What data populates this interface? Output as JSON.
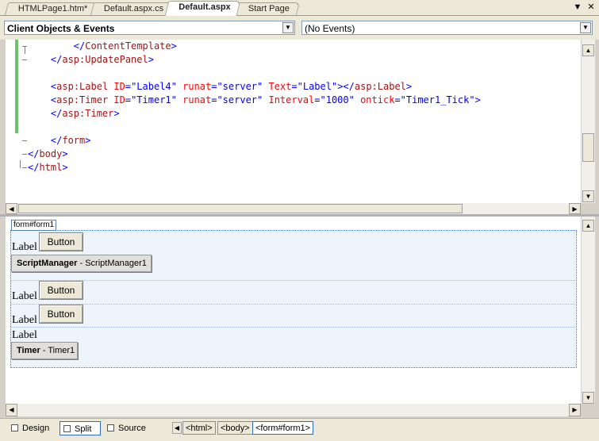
{
  "tabs": [
    {
      "label": "HTMLPage1.htm*"
    },
    {
      "label": "Default.aspx.cs"
    },
    {
      "label": "Default.aspx"
    },
    {
      "label": "Start Page"
    }
  ],
  "tab_controls": {
    "dropdown": "▼",
    "close": "✕"
  },
  "object_dropdown": {
    "value": "Client Objects & Events"
  },
  "event_dropdown": {
    "value": "(No Events)"
  },
  "code": {
    "lines": [
      {
        "indent": "        ",
        "parts": [
          [
            "t-blue",
            "</"
          ],
          [
            "t-tag",
            "ContentTemplate"
          ],
          [
            "t-blue",
            ">"
          ]
        ]
      },
      {
        "indent": "    ",
        "parts": [
          [
            "t-blue",
            "</"
          ],
          [
            "t-tag",
            "asp:UpdatePanel"
          ],
          [
            "t-blue",
            ">"
          ]
        ]
      },
      {
        "indent": "",
        "parts": []
      },
      {
        "indent": "    ",
        "parts": [
          [
            "t-blue",
            "<"
          ],
          [
            "t-tag",
            "asp:Label"
          ],
          [
            "t-blue",
            " "
          ],
          [
            "t-attr",
            "ID"
          ],
          [
            "t-blue",
            "=\"Label4\" "
          ],
          [
            "t-attr",
            "runat"
          ],
          [
            "t-blue",
            "=\"server\" "
          ],
          [
            "t-attr",
            "Text"
          ],
          [
            "t-blue",
            "=\"Label\"></"
          ],
          [
            "t-tag",
            "asp:Label"
          ],
          [
            "t-blue",
            ">"
          ]
        ]
      },
      {
        "indent": "    ",
        "parts": [
          [
            "t-blue",
            "<"
          ],
          [
            "t-tag",
            "asp:Timer"
          ],
          [
            "t-blue",
            " "
          ],
          [
            "t-attr",
            "ID"
          ],
          [
            "t-blue",
            "=\"Timer1\" "
          ],
          [
            "t-attr",
            "runat"
          ],
          [
            "t-blue",
            "=\"server\" "
          ],
          [
            "t-attr",
            "Interval"
          ],
          [
            "t-blue",
            "=\"1000\" "
          ],
          [
            "t-attr",
            "ontick"
          ],
          [
            "t-blue",
            "=\"Timer1_Tick\">"
          ]
        ]
      },
      {
        "indent": "    ",
        "parts": [
          [
            "t-blue",
            "</"
          ],
          [
            "t-tag",
            "asp:Timer"
          ],
          [
            "t-blue",
            ">"
          ]
        ]
      },
      {
        "indent": "",
        "parts": []
      },
      {
        "indent": "    ",
        "parts": [
          [
            "t-blue",
            "</"
          ],
          [
            "t-tag",
            "form"
          ],
          [
            "t-blue",
            ">"
          ]
        ]
      },
      {
        "indent": "",
        "parts": [
          [
            "t-blue",
            "</"
          ],
          [
            "t-tag",
            "body"
          ],
          [
            "t-blue",
            ">"
          ]
        ]
      },
      {
        "indent": "",
        "parts": [
          [
            "t-blue",
            "</"
          ],
          [
            "t-tag",
            "html"
          ],
          [
            "t-blue",
            ">"
          ]
        ]
      }
    ]
  },
  "design": {
    "form_tag": "form#form1",
    "label_text": "Label",
    "button_text": "Button",
    "script_manager": {
      "type": "ScriptManager",
      "id": "- ScriptManager1"
    },
    "timer": {
      "type": "Timer",
      "id": "- Timer1"
    }
  },
  "views": {
    "design": "Design",
    "split": "Split",
    "source": "Source",
    "selected": "Split"
  },
  "breadcrumbs": [
    "<html>",
    "<body>",
    "<form#form1>"
  ],
  "scroll_arrows": {
    "up": "▲",
    "down": "▼",
    "left": "◀",
    "right": "▶",
    "combo": "▼"
  }
}
